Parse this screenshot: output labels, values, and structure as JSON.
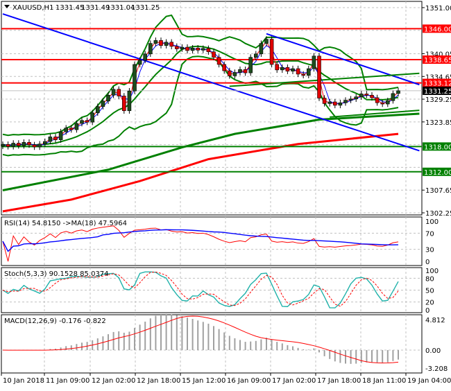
{
  "header": {
    "symbol": "XAUUSD,H1",
    "open": "1331.45",
    "high": "1331.49",
    "low": "1331.04",
    "close": "1331.25"
  },
  "indicators": {
    "rsi_label": "RSI(14) 54.8150  ->MA(18) 47.5964",
    "stoch_label": "Stoch(5,3,3) 90.1528 85.0374",
    "macd_label": "MACD(12,26,9) -0.176 -0.822"
  },
  "colors": {
    "bull": "#1e4d1e",
    "bear": "#e00000",
    "resistance": "#ff0000",
    "support": "#008000",
    "trend": "#0000ff",
    "current": "#000000"
  },
  "chart_data": {
    "type": "candlestick",
    "symbol": "XAUUSD",
    "timeframe": "H1",
    "ylim": [
      1302.25,
      1351.0
    ],
    "price_ticks": [
      "1351.00",
      "1340.05",
      "1334.65",
      "1329.25",
      "1323.85",
      "1307.65",
      "1302.25"
    ],
    "time_labels": [
      "10 Jan 2018",
      "11 Jan 09:00",
      "12 Jan 02:00",
      "12 Jan 18:00",
      "15 Jan 12:00",
      "16 Jan 09:00",
      "17 Jan 02:00",
      "17 Jan 18:00",
      "18 Jan 11:00",
      "19 Jan 04:00"
    ],
    "closes": [
      1318.5,
      1318.0,
      1318.8,
      1318.2,
      1319.0,
      1318.4,
      1317.9,
      1318.6,
      1319.2,
      1320.3,
      1319.6,
      1321.5,
      1322.4,
      1322.0,
      1323.5,
      1324.2,
      1323.8,
      1326.0,
      1327.5,
      1328.8,
      1330.2,
      1331.6,
      1330.0,
      1326.5,
      1331.2,
      1337.5,
      1338.5,
      1340.0,
      1342.5,
      1343.2,
      1342.0,
      1342.8,
      1341.8,
      1341.2,
      1341.6,
      1340.8,
      1341.4,
      1340.9,
      1341.3,
      1340.5,
      1339.2,
      1337.5,
      1336.0,
      1334.8,
      1335.6,
      1336.3,
      1335.5,
      1339.2,
      1340.0,
      1342.5,
      1343.5,
      1337.5,
      1336.2,
      1336.8,
      1335.9,
      1336.5,
      1335.2,
      1334.9,
      1336.5,
      1339.5,
      1329.5,
      1328.2,
      1328.6,
      1327.8,
      1328.4,
      1329.0,
      1329.3,
      1329.8,
      1330.5,
      1330.2,
      1329.6,
      1328.4,
      1328.1,
      1328.9,
      1330.6,
      1331.25
    ],
    "levels": [
      {
        "price": 1346.0,
        "label": "1346.00",
        "kind": "resistance"
      },
      {
        "price": 1338.65,
        "label": "1338.65",
        "kind": "resistance"
      },
      {
        "price": 1333.12,
        "label": "1333.12",
        "kind": "resistance"
      },
      {
        "price": 1318.0,
        "label": "1318.00",
        "kind": "support"
      },
      {
        "price": 1312.0,
        "label": "1312.00",
        "kind": "support"
      }
    ],
    "current_price": {
      "price": 1331.25,
      "label": "1331.25"
    },
    "trendlines": [
      {
        "color": "trend",
        "from": [
          0,
          1349.5
        ],
        "to": [
          79,
          1317.0
        ]
      },
      {
        "color": "trend",
        "from": [
          50,
          1344.8
        ],
        "to": [
          79,
          1332.7
        ]
      },
      {
        "color": "support",
        "from": [
          43,
          1332.3
        ],
        "to": [
          79,
          1335.4
        ]
      },
      {
        "color": "support",
        "from": [
          62,
          1325.0
        ],
        "to": [
          79,
          1326.6
        ]
      }
    ],
    "moving_averages": [
      {
        "color": "support",
        "points": [
          [
            0,
            1307.6
          ],
          [
            20,
            1312.5
          ],
          [
            34,
            1317.8
          ],
          [
            44,
            1321.0
          ],
          [
            60,
            1324.4
          ],
          [
            79,
            1325.8
          ]
        ]
      },
      {
        "color": "resistance",
        "points": [
          [
            0,
            1302.6
          ],
          [
            13,
            1305.4
          ],
          [
            26,
            1309.8
          ],
          [
            39,
            1315.0
          ],
          [
            56,
            1318.6
          ],
          [
            75,
            1321.0
          ]
        ]
      }
    ],
    "rsi_axis": [
      "100",
      "70",
      "30",
      "0"
    ],
    "stoch_axis": [
      "100",
      "80",
      "50",
      "20",
      "0"
    ],
    "macd_axis": [
      "4.812",
      "0.00",
      "-3.208"
    ]
  }
}
